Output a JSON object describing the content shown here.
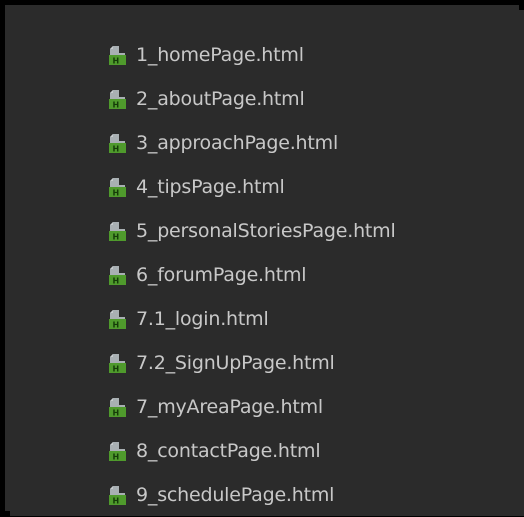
{
  "project_tree": {
    "icon": "html-file-icon",
    "colors": {
      "background": "#2b2b2b",
      "border": "#000000",
      "text": "#c8c8c8",
      "icon_green": "#4f9a2c",
      "icon_grey": "#a9b0b3"
    },
    "files": [
      {
        "name": "1_homePage.html"
      },
      {
        "name": "2_aboutPage.html"
      },
      {
        "name": "3_approachPage.html"
      },
      {
        "name": "4_tipsPage.html"
      },
      {
        "name": "5_personalStoriesPage.html"
      },
      {
        "name": "6_forumPage.html"
      },
      {
        "name": "7.1_login.html"
      },
      {
        "name": "7.2_SignUpPage.html"
      },
      {
        "name": "7_myAreaPage.html"
      },
      {
        "name": "8_contactPage.html"
      },
      {
        "name": "9_schedulePage.html"
      }
    ]
  }
}
